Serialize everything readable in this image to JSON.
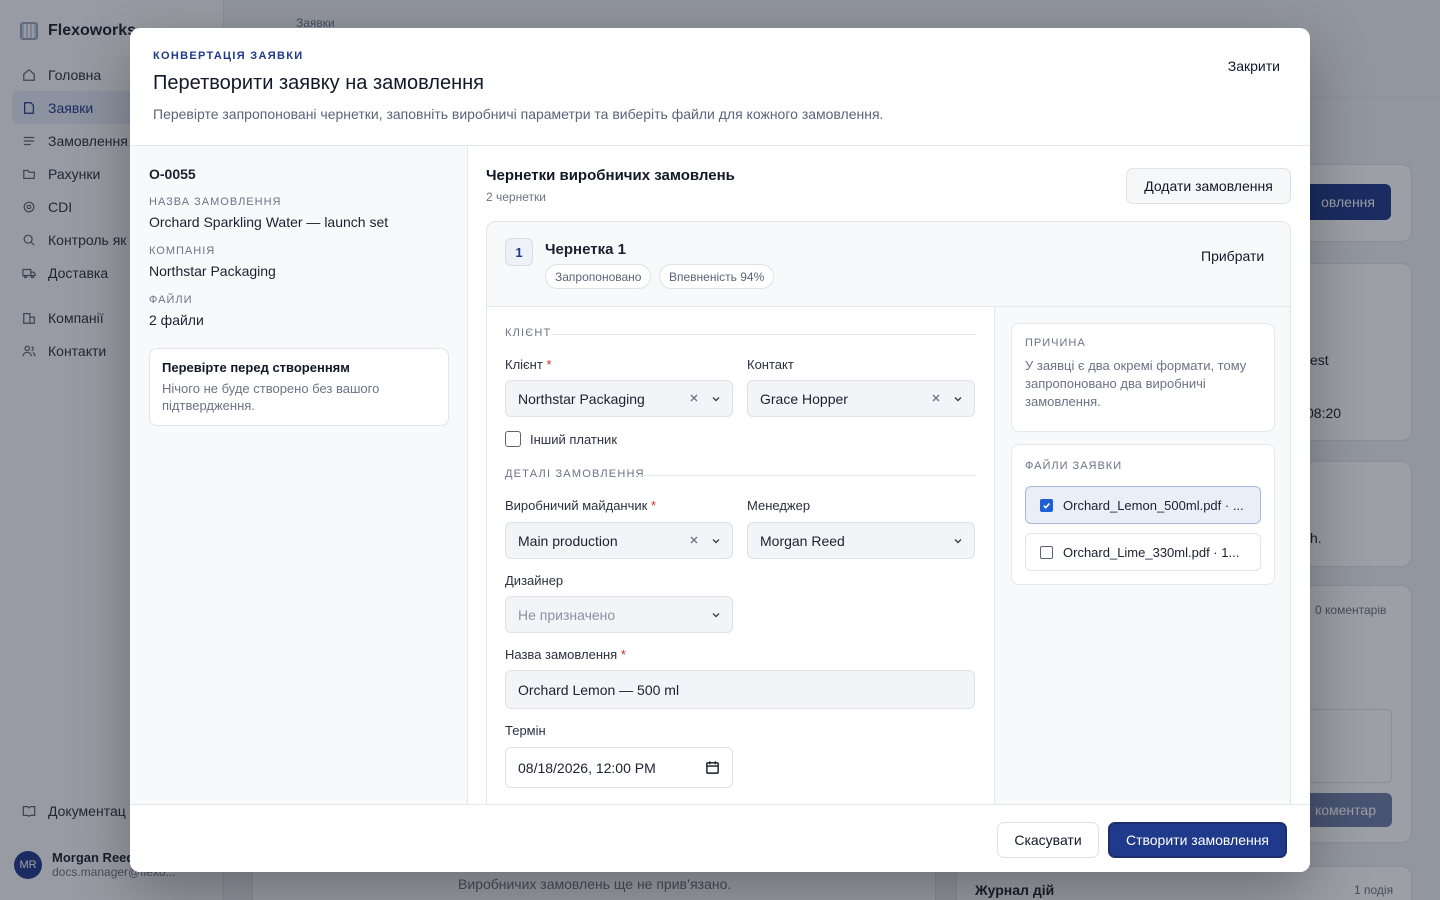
{
  "app": {
    "brand": "Flexoworks",
    "nav": [
      {
        "label": "Головна",
        "icon": "home-icon"
      },
      {
        "label": "Заявки",
        "icon": "document-icon",
        "active": true
      },
      {
        "label": "Замовлення",
        "icon": "list-icon"
      },
      {
        "label": "Рахунки",
        "icon": "folder-icon"
      },
      {
        "label": "CDI",
        "icon": "target-icon"
      },
      {
        "label": "Контроль як",
        "icon": "search-icon"
      },
      {
        "label": "Доставка",
        "icon": "truck-icon"
      },
      {
        "label": "Компанії",
        "icon": "building-icon"
      },
      {
        "label": "Контакти",
        "icon": "users-icon"
      }
    ],
    "docs_label": "Документац",
    "user": {
      "initials": "MR",
      "name": "Morgan Reed",
      "email": "docs.manager@flexo..."
    },
    "breadcrumb": "Заявки",
    "bg_button": "овлення",
    "bg_text_1": "est",
    "bg_text_2": "08:20",
    "bg_text_3": "h.",
    "bg_comments": "0 коментарів",
    "bg_comment_btn": "коментар",
    "bg_journal": "Журнал дій",
    "bg_journal_count": "1 подія",
    "bg_empty": "Виробничих замовлень ще не прив’язано."
  },
  "modal": {
    "eyebrow": "КОНВЕРТАЦІЯ ЗАЯВКИ",
    "title": "Перетворити заявку на замовлення",
    "subtitle": "Перевірте запропоновані чернетки, заповніть виробничі параметри та виберіть файли для кожного замовлення.",
    "close_label": "Закрити",
    "summary": {
      "order_id": "O-0055",
      "name_label": "НАЗВА ЗАМОВЛЕННЯ",
      "name_value": "Orchard Sparkling Water — launch set",
      "company_label": "КОМПАНІЯ",
      "company_value": "Northstar Packaging",
      "files_label": "ФАЙЛИ",
      "files_value": "2 файли",
      "notice_title": "Перевірте перед створенням",
      "notice_text": "Нічого не буде створено без вашого підтвердження."
    },
    "drafts": {
      "title": "Чернетки виробничих замовлень",
      "count": "2 чернетки",
      "add_label": "Додати замовлення"
    },
    "draft": {
      "number": "1",
      "title": "Чернетка 1",
      "chips": [
        "Запропоновано",
        "Впевненість 94%"
      ],
      "remove_label": "Прибрати",
      "client_section": "КЛІЄНТ",
      "client_label": "Клієнт",
      "client_value": "Northstar Packaging",
      "contact_label": "Контакт",
      "contact_value": "Grace Hopper",
      "other_payer_label": "Інший платник",
      "details_section": "ДЕТАЛІ ЗАМОВЛЕННЯ",
      "site_label": "Виробничий майданчик",
      "site_value": "Main production",
      "manager_label": "Менеджер",
      "manager_value": "Morgan Reed",
      "designer_label": "Дизайнер",
      "designer_value": "Не призначено",
      "order_name_label": "Назва замовлення",
      "order_name_value": "Orchard Lemon — 500 ml",
      "due_label": "Термін",
      "due_value": "08/18/2026, 12:00 PM",
      "required_mark": "*"
    },
    "reason": {
      "title": "ПРИЧИНА",
      "text": "У заявці є два окремі формати, тому запропоновано два виробничі замовлення."
    },
    "files": {
      "title": "ФАЙЛИ ЗАЯВКИ",
      "items": [
        {
          "label": "Orchard_Lemon_500ml.pdf · ...",
          "checked": true
        },
        {
          "label": "Orchard_Lime_330ml.pdf · 1...",
          "checked": false
        }
      ]
    },
    "footer": {
      "cancel_label": "Скасувати",
      "create_label": "Створити замовлення"
    }
  },
  "colors": {
    "accent": "#1f3a8a",
    "required": "#d02b2b",
    "checkbox": "#1f5fd6"
  }
}
